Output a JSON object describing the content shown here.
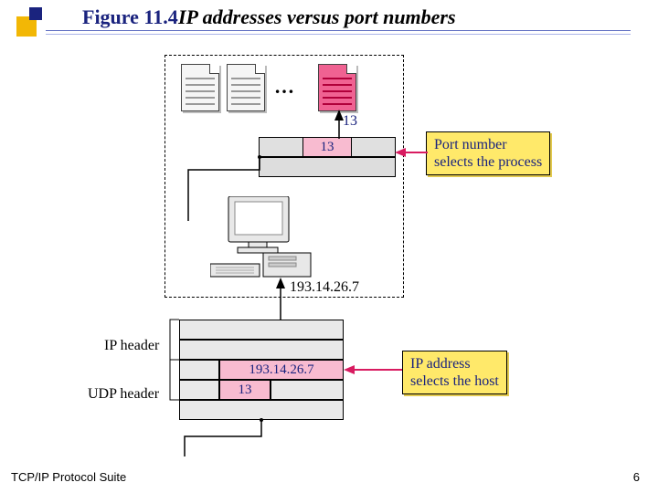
{
  "title": {
    "fig_num": "Figure 11.4",
    "fig_title": "IP addresses versus port numbers"
  },
  "diagram": {
    "ellipsis": "…",
    "port_segment_label": "13",
    "port_value_right": "13",
    "callout_port": "Port number\nselects the process",
    "host_ip": "193.14.26.7",
    "ip_header_label": "IP header",
    "udp_header_label": "UDP  header",
    "dest_ip_value": "193.14.26.7",
    "dest_port_value": "13",
    "callout_ipaddr": "IP address\nselects the host"
  },
  "footer": {
    "book": "TCP/IP Protocol Suite",
    "page": "6"
  }
}
